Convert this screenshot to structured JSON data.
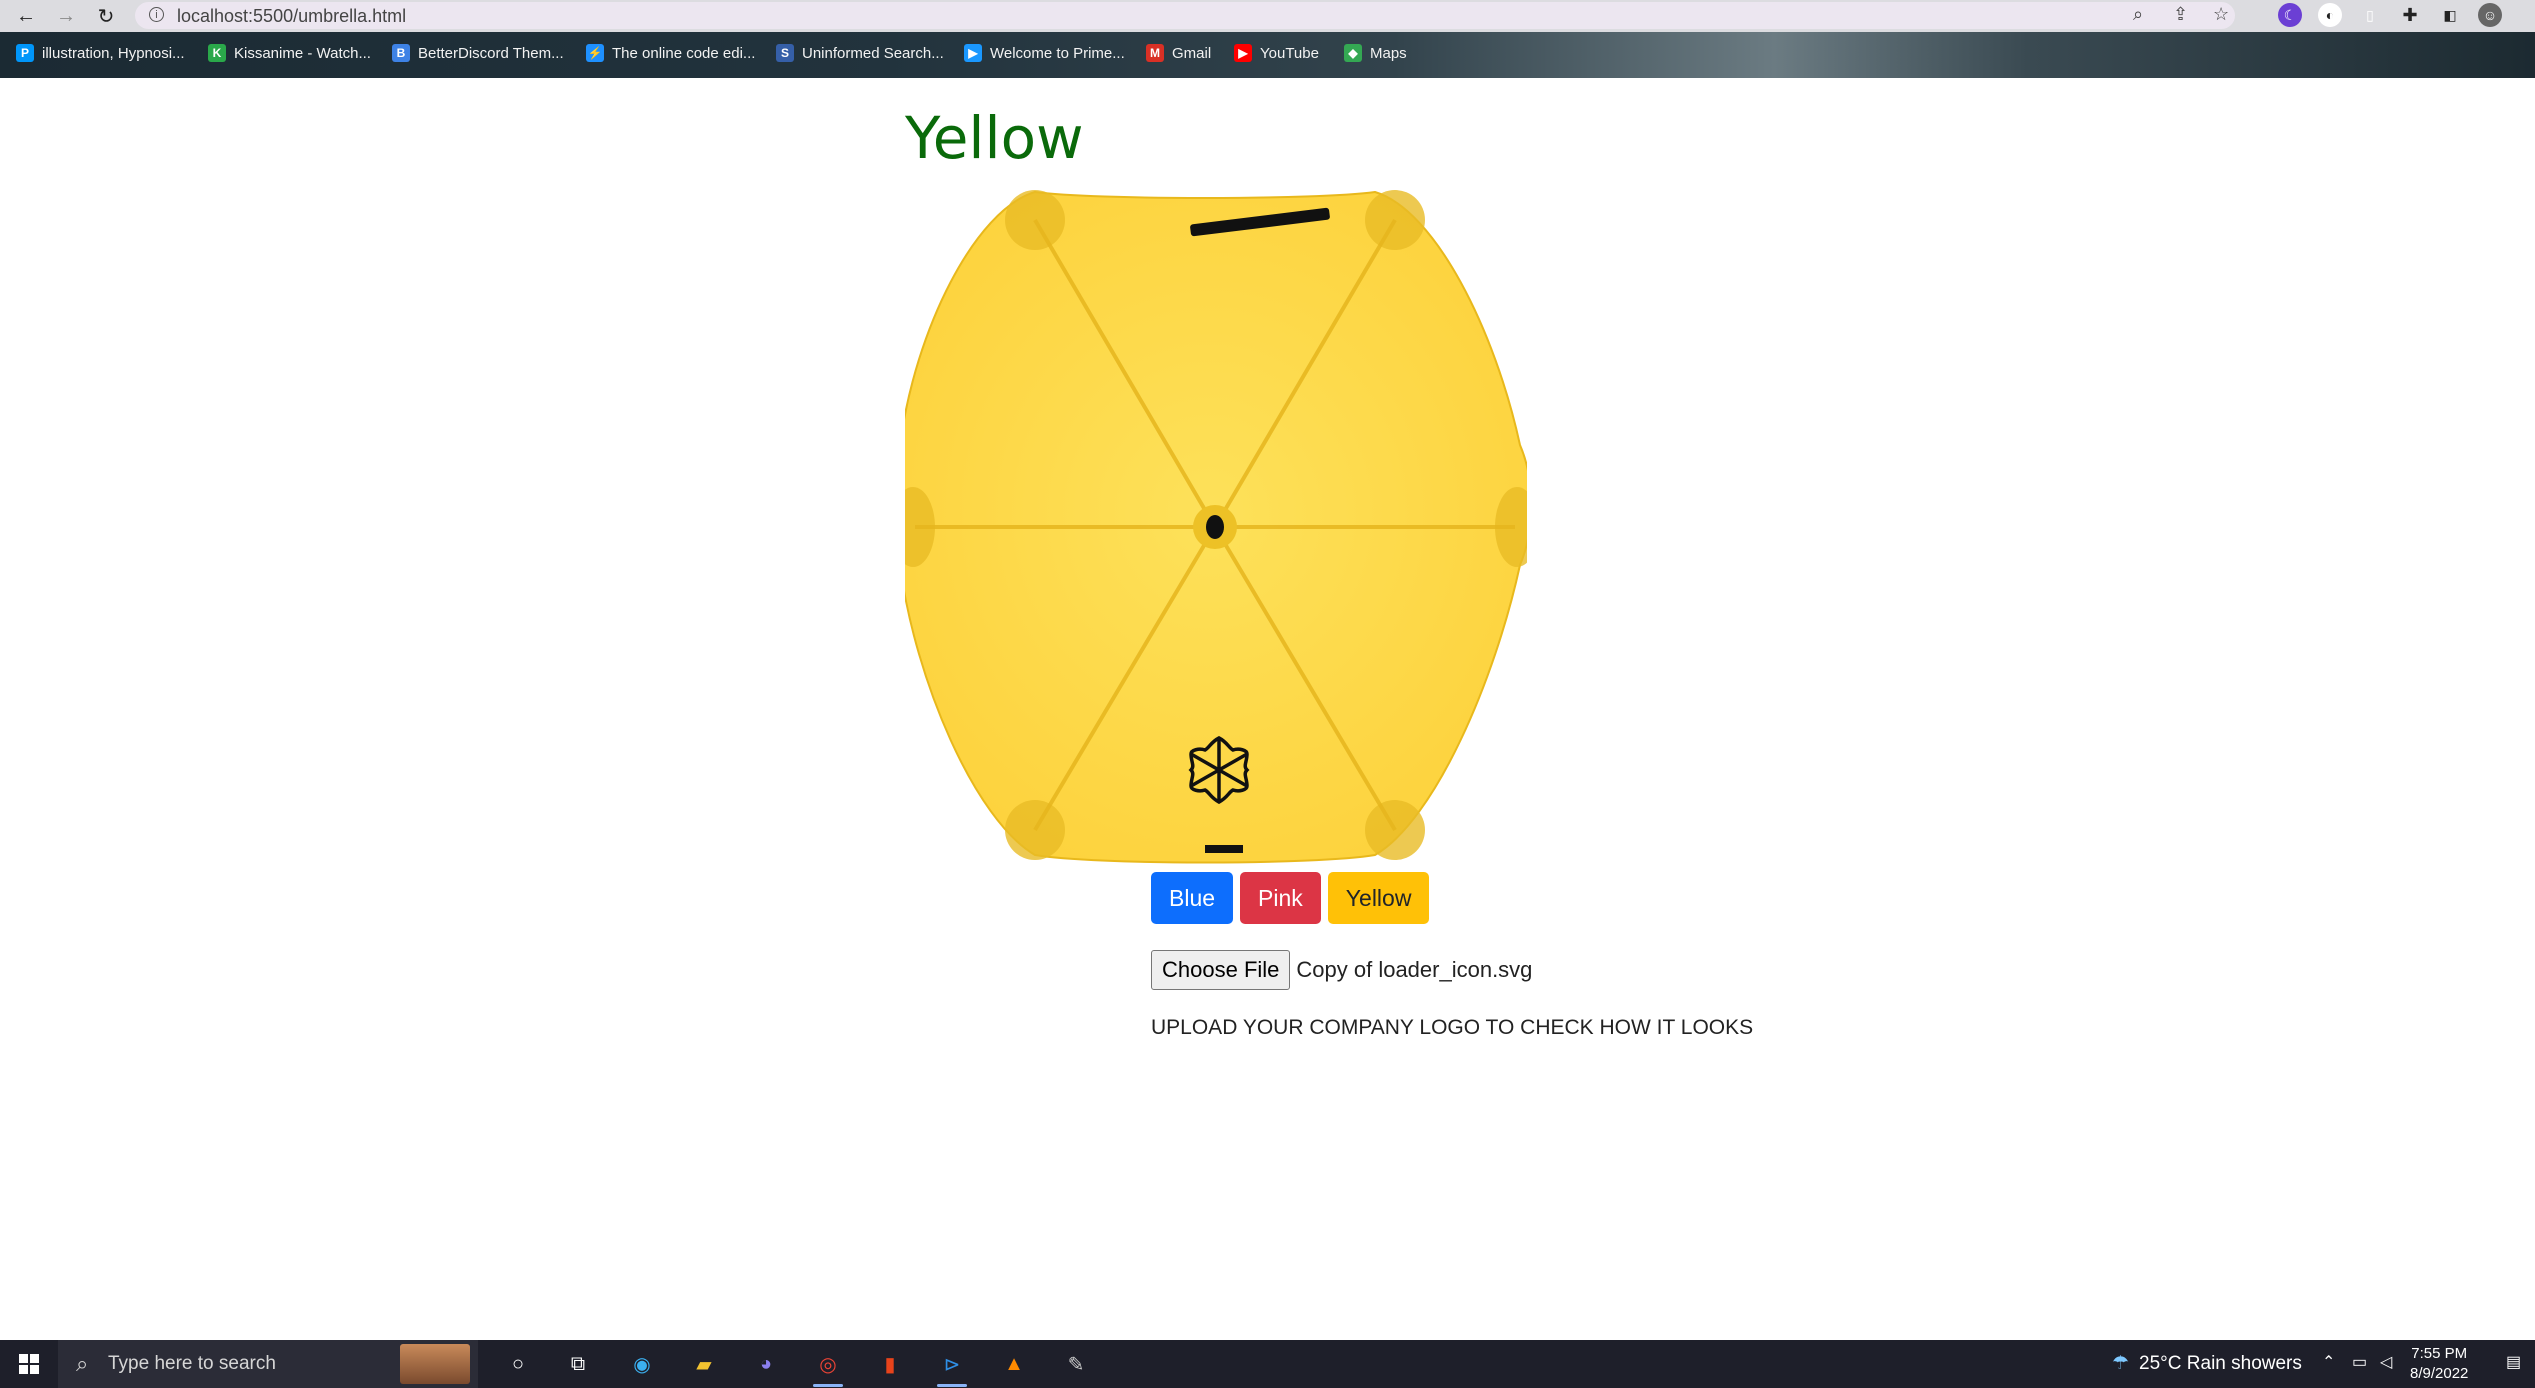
{
  "browser": {
    "url": "localhost:5500/umbrella.html",
    "bookmarks": [
      {
        "label": "illustration, Hypnosi...",
        "icon": "pixiv-icon",
        "color": "#0096fa",
        "glyph": "P"
      },
      {
        "label": "Kissanime - Watch...",
        "icon": "kissanime-icon",
        "color": "#2aa84a",
        "glyph": "K"
      },
      {
        "label": "BetterDiscord Them...",
        "icon": "betterdiscord-icon",
        "color": "#3e82e5",
        "glyph": "B"
      },
      {
        "label": "The online code edi...",
        "icon": "lightning-icon",
        "color": "#1e90ff",
        "glyph": "⚡"
      },
      {
        "label": "Uninformed Search...",
        "icon": "site-icon",
        "color": "#355fa8",
        "glyph": "S"
      },
      {
        "label": "Welcome to Prime...",
        "icon": "prime-icon",
        "color": "#1a98ff",
        "glyph": "▶"
      },
      {
        "label": "Gmail",
        "icon": "gmail-icon",
        "color": "#d93025",
        "glyph": "M"
      },
      {
        "label": "YouTube",
        "icon": "youtube-icon",
        "color": "#ff0000",
        "glyph": "▶"
      },
      {
        "label": "Maps",
        "icon": "maps-icon",
        "color": "#34a853",
        "glyph": "◆"
      }
    ]
  },
  "page": {
    "title": "Yellow",
    "umbrella_color": "#fdd23c",
    "buttons": {
      "blue": "Blue",
      "pink": "Pink",
      "yellow": "Yellow"
    },
    "file_input": {
      "button": "Choose File",
      "file_name": "Copy of loader_icon.svg"
    },
    "upload_hint": "UPLOAD YOUR COMPANY LOGO TO CHECK HOW IT LOOKS"
  },
  "taskbar": {
    "search_placeholder": "Type here to search",
    "weather": "25°C  Rain showers",
    "time": "7:55 PM",
    "date": "8/9/2022"
  }
}
